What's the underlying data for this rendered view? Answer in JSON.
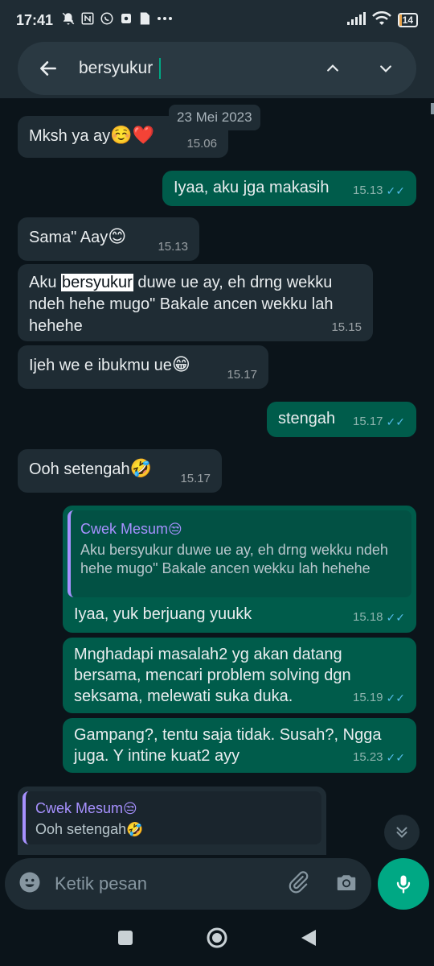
{
  "status_bar": {
    "time": "17:41",
    "battery": "14"
  },
  "search": {
    "query": "bersyukur"
  },
  "date_chip": "23 Mei 2023",
  "messages": [
    {
      "text": "Mksh ya ay",
      "emoji": "☺️❤️",
      "time": "15.06"
    },
    {
      "text": "Iyaa, aku jga makasih",
      "time": "15.13"
    },
    {
      "text": "Sama\" Aay",
      "emoji": "😊",
      "time": "15.13"
    },
    {
      "text_before": "Aku ",
      "highlight": "bersyukur",
      "text_after": " duwe ue ay, eh drng wekku ndeh hehe mugo\" Bakale ancen wekku lah hehehe",
      "time": "15.15"
    },
    {
      "text": "Ijeh we e ibukmu ue",
      "emoji": "😁",
      "time": "15.17"
    },
    {
      "text": "stengah",
      "time": "15.17"
    },
    {
      "text": "Ooh setengah",
      "emoji": "🤣",
      "time": "15.17"
    },
    {
      "quote_name": "Cwek Mesum",
      "quote_emoji": "😒",
      "quote_text": "Aku bersyukur duwe ue ay, eh drng wekku ndeh hehe mugo\" Bakale ancen wekku lah hehehe",
      "text": "Iyaa, yuk berjuang yuukk",
      "time": "15.18"
    },
    {
      "text": "Mnghadapi masalah2 yg akan datang bersama, mencari problem solving dgn seksama, melewati suka duka.",
      "time": "15.19"
    },
    {
      "text": "Gampang?, tentu saja tidak. Susah?, Ngga juga. Y intine kuat2 ayy",
      "time": "15.23"
    },
    {
      "quote_name": "Cwek Mesum",
      "quote_emoji": "😒",
      "quote_text": "Ooh setengah",
      "quote_text_emoji": "🤣"
    }
  ],
  "composer": {
    "placeholder": "Ketik pesan"
  },
  "colors": {
    "background": "#0b141a",
    "incoming": "#1f2c34",
    "outgoing": "#005c4b",
    "accent": "#00a884",
    "read_tick": "#53bdeb",
    "quote_name": "#a791ff"
  }
}
